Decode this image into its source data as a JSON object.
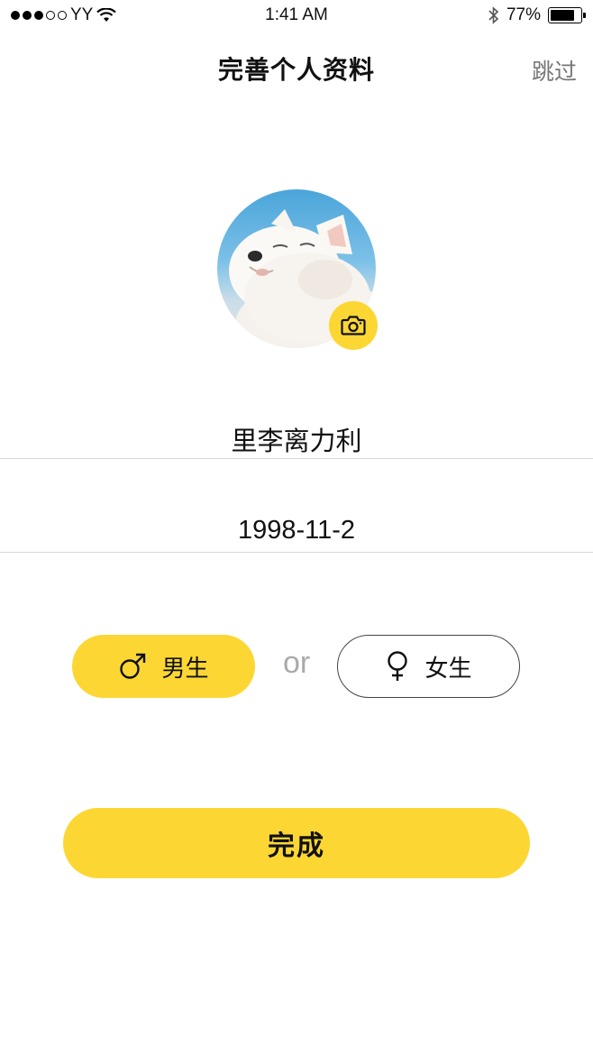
{
  "status_bar": {
    "carrier": "YY",
    "time": "1:41 AM",
    "battery": "77%",
    "battery_level": 0.77,
    "signal_bars_filled": 3,
    "signal_bars_total": 5,
    "icons": [
      "signal-dots-icon",
      "wifi-icon",
      "bluetooth-icon",
      "battery-icon"
    ]
  },
  "nav": {
    "title": "完善个人资料",
    "skip_label": "跳过"
  },
  "avatar": {
    "image": "white-puppy-avatar",
    "badge_icon": "camera-icon",
    "badge_color": "#fcd734"
  },
  "form": {
    "nickname": "里李离力利",
    "birthday": "1998-11-2"
  },
  "gender": {
    "male_label": "男生",
    "male_icon": "male-symbol-icon",
    "or_label": "or",
    "female_label": "女生",
    "female_icon": "female-symbol-icon",
    "selected": "male"
  },
  "actions": {
    "done_label": "完成"
  },
  "colors": {
    "accent": "#fcd734",
    "text": "#111111",
    "muted": "#777777",
    "divider": "#d8d8d8"
  }
}
